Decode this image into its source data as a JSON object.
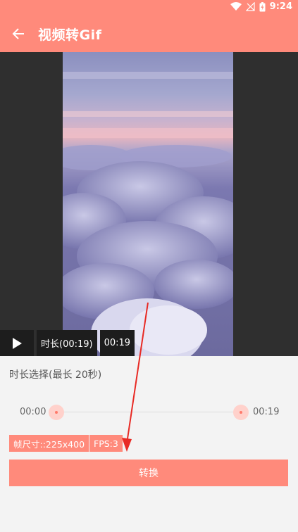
{
  "status_bar": {
    "time": "9:24",
    "icons": [
      "wifi-icon",
      "signal-off-icon",
      "battery-icon"
    ]
  },
  "app_bar": {
    "title": "视频转Gif",
    "back_icon": "arrow-left-icon"
  },
  "player": {
    "play_icon": "play-icon",
    "duration_label": "时长(00:19)",
    "current_time": "00:19"
  },
  "range": {
    "label": "时长选择(最长 20秒)",
    "start": "00:00",
    "end": "00:19"
  },
  "options": {
    "frame_size": "帧尺寸::225x400",
    "fps": "FPS:3"
  },
  "convert_button": "转换",
  "colors": {
    "accent": "#ff8a7b",
    "accent_light": "#ffd1cb",
    "annotation_arrow": "#e82a24"
  }
}
